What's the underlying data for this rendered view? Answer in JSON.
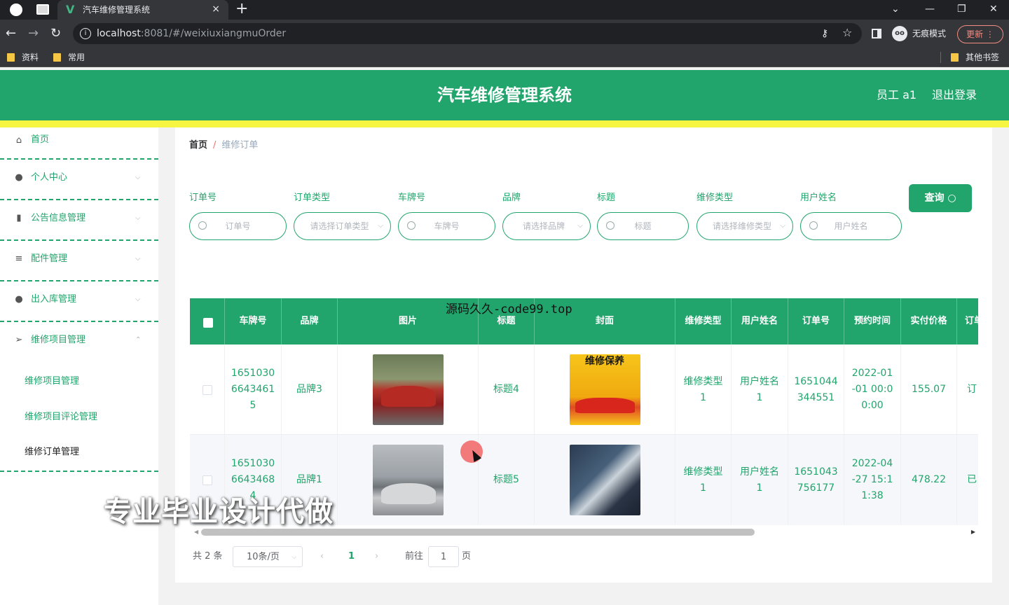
{
  "browser": {
    "tab_title": "汽车维修管理系统",
    "tab_close": "×",
    "new_tab": "+",
    "url_host": "localhost",
    "url_rest": ":8081/#/weixiuxiangmuOrder",
    "incognito": "无痕模式",
    "update_label": "更新",
    "bookmarks": [
      "资料",
      "常用"
    ],
    "other_bookmarks": "其他书签"
  },
  "header": {
    "title": "汽车维修管理系统",
    "user": "员工 a1",
    "logout": "退出登录"
  },
  "sidebar": {
    "items": [
      {
        "label": "首页",
        "icon": "home-icon"
      },
      {
        "label": "个人中心",
        "icon": "user-icon"
      },
      {
        "label": "公告信息管理",
        "icon": "chart-icon"
      },
      {
        "label": "配件管理",
        "icon": "sliders-icon"
      },
      {
        "label": "出入库管理",
        "icon": "pin-icon"
      },
      {
        "label": "维修项目管理",
        "icon": "send-icon"
      }
    ],
    "sub_items": [
      "维修项目管理",
      "维修项目评论管理",
      "维修订单管理"
    ]
  },
  "breadcrumb": {
    "home": "首页",
    "sep": "/",
    "current": "维修订单"
  },
  "filters": [
    {
      "label": "订单号",
      "placeholder": "订单号"
    },
    {
      "label": "订单类型",
      "placeholder": "请选择订单类型"
    },
    {
      "label": "车牌号",
      "placeholder": "车牌号"
    },
    {
      "label": "品牌",
      "placeholder": "请选择品牌"
    },
    {
      "label": "标题",
      "placeholder": "标题"
    },
    {
      "label": "维修类型",
      "placeholder": "请选择维修类型"
    },
    {
      "label": "用户姓名",
      "placeholder": "用户姓名"
    }
  ],
  "query_button": "查询",
  "table": {
    "headers": [
      "车牌号",
      "品牌",
      "图片",
      "标题",
      "封面",
      "维修类型",
      "用户姓名",
      "订单号",
      "预约时间",
      "实付价格",
      "订单"
    ],
    "rows": [
      {
        "plate": [
          "1651030",
          "6643461",
          "5"
        ],
        "brand": "品牌3",
        "title": "标题4",
        "poster_text": "维修保养",
        "repair_type": [
          "维修类型",
          "1"
        ],
        "user": [
          "用户姓名",
          "1"
        ],
        "order": [
          "1651044",
          "344551"
        ],
        "time": [
          "2022-01",
          "-01 00:0",
          "0:00"
        ],
        "price": "155.07",
        "status": "订"
      },
      {
        "plate": [
          "1651030",
          "6643468",
          "4"
        ],
        "brand": "品牌1",
        "title": "标题5",
        "repair_type": [
          "维修类型",
          "1"
        ],
        "user": [
          "用户姓名",
          "1"
        ],
        "order": [
          "1651043",
          "756177"
        ],
        "time": [
          "2022-04",
          "-27 15:1",
          "1:38"
        ],
        "price": "478.22",
        "status": "已"
      }
    ]
  },
  "pagination": {
    "total": "共 2 条",
    "page_size": "10条/页",
    "current": "1",
    "goto": "前往",
    "goto_value": "1",
    "page_unit": "页"
  },
  "overlays": {
    "watermark": "源码久久-code99.top",
    "ad_text": "专业毕业设计代做"
  },
  "colors": {
    "accent": "#21a56c",
    "strip": "#f5f542"
  }
}
